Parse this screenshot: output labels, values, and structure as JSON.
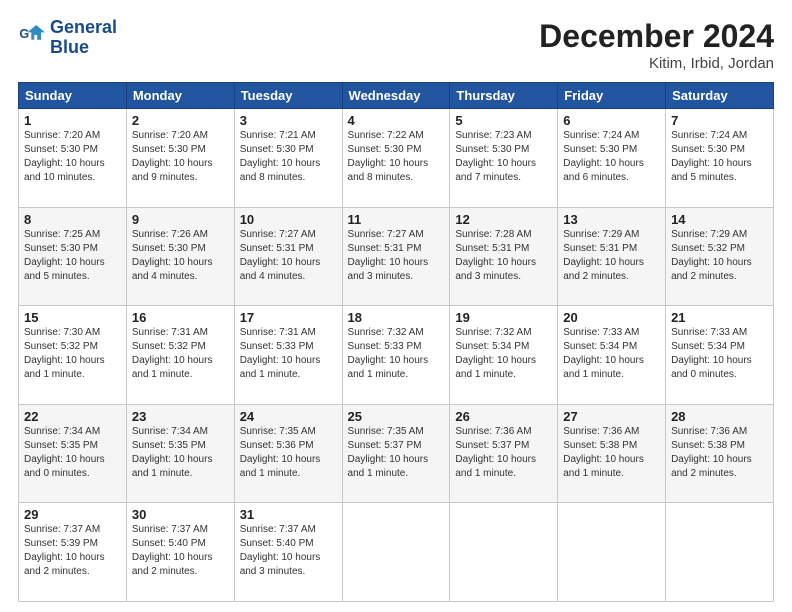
{
  "logo": {
    "line1": "General",
    "line2": "Blue"
  },
  "title": "December 2024",
  "subtitle": "Kitim, Irbid, Jordan",
  "weekdays": [
    "Sunday",
    "Monday",
    "Tuesday",
    "Wednesday",
    "Thursday",
    "Friday",
    "Saturday"
  ],
  "weeks": [
    [
      {
        "day": 1,
        "info": "Sunrise: 7:20 AM\nSunset: 5:30 PM\nDaylight: 10 hours\nand 10 minutes."
      },
      {
        "day": 2,
        "info": "Sunrise: 7:20 AM\nSunset: 5:30 PM\nDaylight: 10 hours\nand 9 minutes."
      },
      {
        "day": 3,
        "info": "Sunrise: 7:21 AM\nSunset: 5:30 PM\nDaylight: 10 hours\nand 8 minutes."
      },
      {
        "day": 4,
        "info": "Sunrise: 7:22 AM\nSunset: 5:30 PM\nDaylight: 10 hours\nand 8 minutes."
      },
      {
        "day": 5,
        "info": "Sunrise: 7:23 AM\nSunset: 5:30 PM\nDaylight: 10 hours\nand 7 minutes."
      },
      {
        "day": 6,
        "info": "Sunrise: 7:24 AM\nSunset: 5:30 PM\nDaylight: 10 hours\nand 6 minutes."
      },
      {
        "day": 7,
        "info": "Sunrise: 7:24 AM\nSunset: 5:30 PM\nDaylight: 10 hours\nand 5 minutes."
      }
    ],
    [
      {
        "day": 8,
        "info": "Sunrise: 7:25 AM\nSunset: 5:30 PM\nDaylight: 10 hours\nand 5 minutes."
      },
      {
        "day": 9,
        "info": "Sunrise: 7:26 AM\nSunset: 5:30 PM\nDaylight: 10 hours\nand 4 minutes."
      },
      {
        "day": 10,
        "info": "Sunrise: 7:27 AM\nSunset: 5:31 PM\nDaylight: 10 hours\nand 4 minutes."
      },
      {
        "day": 11,
        "info": "Sunrise: 7:27 AM\nSunset: 5:31 PM\nDaylight: 10 hours\nand 3 minutes."
      },
      {
        "day": 12,
        "info": "Sunrise: 7:28 AM\nSunset: 5:31 PM\nDaylight: 10 hours\nand 3 minutes."
      },
      {
        "day": 13,
        "info": "Sunrise: 7:29 AM\nSunset: 5:31 PM\nDaylight: 10 hours\nand 2 minutes."
      },
      {
        "day": 14,
        "info": "Sunrise: 7:29 AM\nSunset: 5:32 PM\nDaylight: 10 hours\nand 2 minutes."
      }
    ],
    [
      {
        "day": 15,
        "info": "Sunrise: 7:30 AM\nSunset: 5:32 PM\nDaylight: 10 hours\nand 1 minute."
      },
      {
        "day": 16,
        "info": "Sunrise: 7:31 AM\nSunset: 5:32 PM\nDaylight: 10 hours\nand 1 minute."
      },
      {
        "day": 17,
        "info": "Sunrise: 7:31 AM\nSunset: 5:33 PM\nDaylight: 10 hours\nand 1 minute."
      },
      {
        "day": 18,
        "info": "Sunrise: 7:32 AM\nSunset: 5:33 PM\nDaylight: 10 hours\nand 1 minute."
      },
      {
        "day": 19,
        "info": "Sunrise: 7:32 AM\nSunset: 5:34 PM\nDaylight: 10 hours\nand 1 minute."
      },
      {
        "day": 20,
        "info": "Sunrise: 7:33 AM\nSunset: 5:34 PM\nDaylight: 10 hours\nand 1 minute."
      },
      {
        "day": 21,
        "info": "Sunrise: 7:33 AM\nSunset: 5:34 PM\nDaylight: 10 hours\nand 0 minutes."
      }
    ],
    [
      {
        "day": 22,
        "info": "Sunrise: 7:34 AM\nSunset: 5:35 PM\nDaylight: 10 hours\nand 0 minutes."
      },
      {
        "day": 23,
        "info": "Sunrise: 7:34 AM\nSunset: 5:35 PM\nDaylight: 10 hours\nand 1 minute."
      },
      {
        "day": 24,
        "info": "Sunrise: 7:35 AM\nSunset: 5:36 PM\nDaylight: 10 hours\nand 1 minute."
      },
      {
        "day": 25,
        "info": "Sunrise: 7:35 AM\nSunset: 5:37 PM\nDaylight: 10 hours\nand 1 minute."
      },
      {
        "day": 26,
        "info": "Sunrise: 7:36 AM\nSunset: 5:37 PM\nDaylight: 10 hours\nand 1 minute."
      },
      {
        "day": 27,
        "info": "Sunrise: 7:36 AM\nSunset: 5:38 PM\nDaylight: 10 hours\nand 1 minute."
      },
      {
        "day": 28,
        "info": "Sunrise: 7:36 AM\nSunset: 5:38 PM\nDaylight: 10 hours\nand 2 minutes."
      }
    ],
    [
      {
        "day": 29,
        "info": "Sunrise: 7:37 AM\nSunset: 5:39 PM\nDaylight: 10 hours\nand 2 minutes."
      },
      {
        "day": 30,
        "info": "Sunrise: 7:37 AM\nSunset: 5:40 PM\nDaylight: 10 hours\nand 2 minutes."
      },
      {
        "day": 31,
        "info": "Sunrise: 7:37 AM\nSunset: 5:40 PM\nDaylight: 10 hours\nand 3 minutes."
      },
      null,
      null,
      null,
      null
    ]
  ]
}
